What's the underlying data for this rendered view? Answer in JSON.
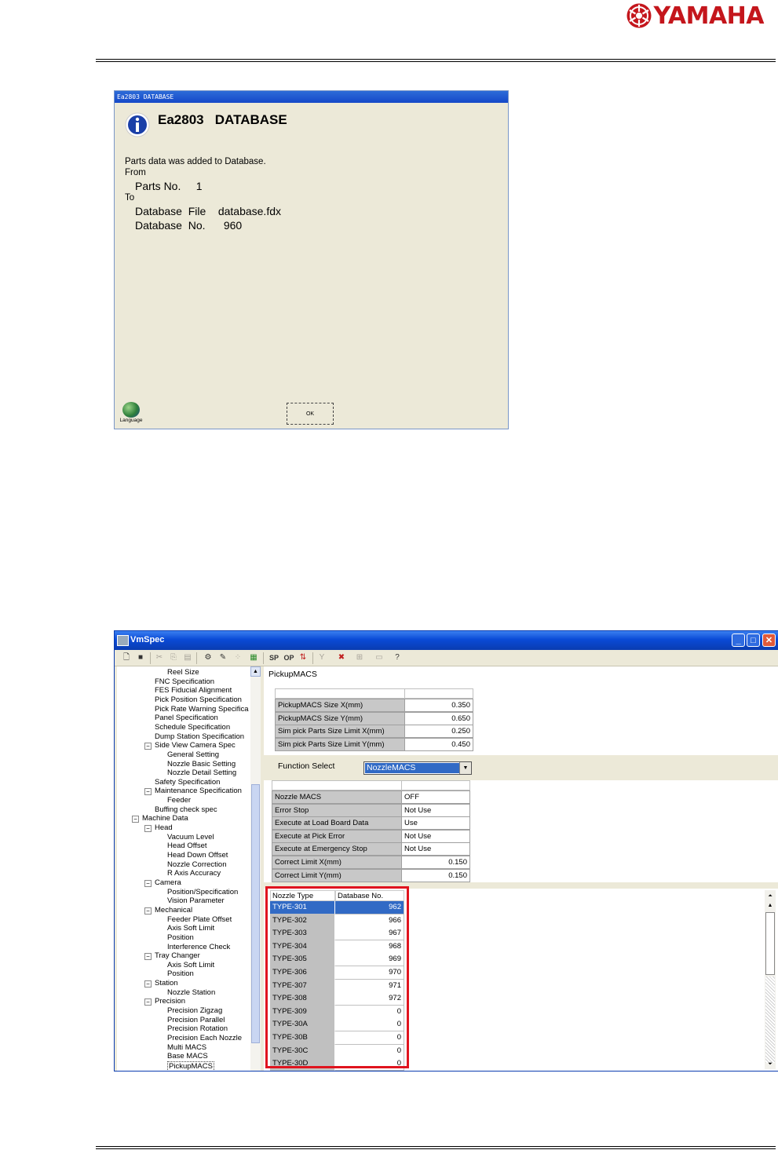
{
  "brand": {
    "name": "YAMAHA",
    "color": "#c4161c"
  },
  "dialog": {
    "title": "Ea2803 DATABASE",
    "heading": "Ea2803   DATABASE",
    "message": "Parts data was added to Database.",
    "from_label": "From",
    "parts_line": "Parts No.     1",
    "to_label": "To",
    "file_line": "Database  File    database.fdx",
    "no_line": "Database  No.      960",
    "language_label": "Language",
    "ok_label": "OK",
    "icon": "info-icon"
  },
  "vmspec": {
    "title": "VmSpec",
    "toolbar": {
      "sp": "SP",
      "op": "OP"
    },
    "tree": [
      {
        "label": "Reel Size",
        "level": 3
      },
      {
        "label": "FNC Specification",
        "level": 2
      },
      {
        "label": "FES Fiducial Alignment",
        "level": 2
      },
      {
        "label": "Pick Position Specification",
        "level": 2
      },
      {
        "label": "Pick Rate Warning Specifica",
        "level": 2
      },
      {
        "label": "Panel Specification",
        "level": 2
      },
      {
        "label": "Schedule Specification",
        "level": 2
      },
      {
        "label": "Dump Station Specification",
        "level": 2
      },
      {
        "label": "Side View Camera Spec",
        "level": 2,
        "expander": "−"
      },
      {
        "label": "General Setting",
        "level": 3
      },
      {
        "label": "Nozzle Basic Setting",
        "level": 3
      },
      {
        "label": "Nozzle Detail Setting",
        "level": 3
      },
      {
        "label": "Safety Specification",
        "level": 2
      },
      {
        "label": "Maintenance Specification",
        "level": 2,
        "expander": "−"
      },
      {
        "label": "Feeder",
        "level": 3
      },
      {
        "label": "Buffing check spec",
        "level": 2
      },
      {
        "label": "Machine Data",
        "level": 1,
        "expander": "−"
      },
      {
        "label": "Head",
        "level": 2,
        "expander": "−"
      },
      {
        "label": "Vacuum Level",
        "level": 3
      },
      {
        "label": "Head Offset",
        "level": 3
      },
      {
        "label": "Head Down Offset",
        "level": 3
      },
      {
        "label": "Nozzle Correction",
        "level": 3
      },
      {
        "label": "R Axis Accuracy",
        "level": 3
      },
      {
        "label": "Camera",
        "level": 2,
        "expander": "−"
      },
      {
        "label": "Position/Specification",
        "level": 3
      },
      {
        "label": "Vision Parameter",
        "level": 3
      },
      {
        "label": "Mechanical",
        "level": 2,
        "expander": "−"
      },
      {
        "label": "Feeder Plate Offset",
        "level": 3
      },
      {
        "label": "Axis Soft Limit",
        "level": 3
      },
      {
        "label": "Position",
        "level": 3
      },
      {
        "label": "Interference Check",
        "level": 3
      },
      {
        "label": "Tray Changer",
        "level": 2,
        "expander": "−"
      },
      {
        "label": "Axis Soft Limit",
        "level": 3
      },
      {
        "label": "Position",
        "level": 3
      },
      {
        "label": "Station",
        "level": 2,
        "expander": "−"
      },
      {
        "label": "Nozzle Station",
        "level": 3
      },
      {
        "label": "Precision",
        "level": 2,
        "expander": "−"
      },
      {
        "label": "Precision Zigzag",
        "level": 3
      },
      {
        "label": "Precision Parallel",
        "level": 3
      },
      {
        "label": "Precision Rotation",
        "level": 3
      },
      {
        "label": "Precision Each Nozzle",
        "level": 3
      },
      {
        "label": "Multi MACS",
        "level": 3
      },
      {
        "label": "Base MACS",
        "level": 3
      },
      {
        "label": "PickupMACS",
        "level": 3,
        "selected": true
      }
    ],
    "pane_title": "PickupMACS",
    "size_table": [
      {
        "label": "PickupMACS Size X(mm)",
        "value": "0.350"
      },
      {
        "label": "PickupMACS Size Y(mm)",
        "value": "0.650"
      },
      {
        "label": "Sim pick Parts Size Limit X(mm)",
        "value": "0.250"
      },
      {
        "label": "Sim pick Parts Size Limit Y(mm)",
        "value": "0.450"
      }
    ],
    "function_select": {
      "label": "Function Select",
      "value": "NozzleMACS"
    },
    "nozzle_table": [
      {
        "label": "Nozzle MACS",
        "value": "OFF",
        "align": "L"
      },
      {
        "label": "Error Stop",
        "value": "Not Use",
        "align": "L"
      },
      {
        "label": "Execute at Load Board Data",
        "value": "Use",
        "align": "L"
      },
      {
        "label": "Execute at Pick Error",
        "value": "Not Use",
        "align": "L"
      },
      {
        "label": "Execute at Emergency Stop",
        "value": "Not Use",
        "align": "L"
      },
      {
        "label": "Correct Limit X(mm)",
        "value": "0.150",
        "align": "R"
      },
      {
        "label": "Correct Limit Y(mm)",
        "value": "0.150",
        "align": "R"
      }
    ],
    "grid": {
      "headers": [
        "Nozzle Type",
        "Database No."
      ],
      "rows": [
        {
          "type": "TYPE-301",
          "no": "962",
          "selected": true
        },
        {
          "type": "TYPE-302",
          "no": "966"
        },
        {
          "type": "TYPE-303",
          "no": "967"
        },
        {
          "type": "TYPE-304",
          "no": "968"
        },
        {
          "type": "TYPE-305",
          "no": "969"
        },
        {
          "type": "TYPE-306",
          "no": "970"
        },
        {
          "type": "TYPE-307",
          "no": "971"
        },
        {
          "type": "TYPE-308",
          "no": "972"
        },
        {
          "type": "TYPE-309",
          "no": "0"
        },
        {
          "type": "TYPE-30A",
          "no": "0"
        },
        {
          "type": "TYPE-30B",
          "no": "0"
        },
        {
          "type": "TYPE-30C",
          "no": "0"
        },
        {
          "type": "TYPE-30D",
          "no": "0"
        }
      ],
      "highlight_color": "#e0141e"
    }
  }
}
